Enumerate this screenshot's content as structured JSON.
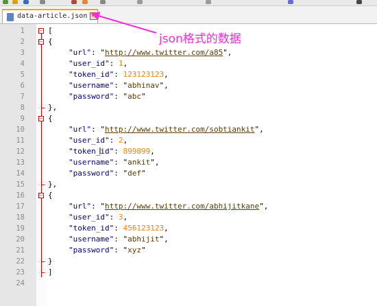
{
  "tab": {
    "filename": "data-article.json",
    "close_glyph": "✕"
  },
  "annotation": {
    "text": "json格式的数据",
    "color": "#ff2bd4"
  },
  "line_numbers": [
    "1",
    "2",
    "3",
    "4",
    "5",
    "6",
    "7",
    "8",
    "9",
    "10",
    "11",
    "12",
    "13",
    "14",
    "15",
    "16",
    "17",
    "18",
    "19",
    "20",
    "21",
    "22",
    "23",
    "24"
  ],
  "code": {
    "l1": "[",
    "l2": "{",
    "records": [
      {
        "url": "http://www.twitter.com/a85",
        "user_id": "1",
        "token_id": "123123123",
        "username": "abhinav",
        "password": "abc"
      },
      {
        "url": "http://www.twitter.com/sobtiankit",
        "user_id": "2",
        "token_id": "899899",
        "username": "ankit",
        "password": "def"
      },
      {
        "url": "http://www.twitter.com/abhijitkane",
        "user_id": "3",
        "token_id": "456123123",
        "username": "abhijit",
        "password": "xyz"
      }
    ],
    "keys": {
      "url": "\"url\"",
      "user_id": "\"user_id\"",
      "token_id": "\"token_id\"",
      "username": "\"username\"",
      "password": "\"password\""
    },
    "close_obj_comma": "},",
    "open_obj": "{",
    "close_obj": "}",
    "close_arr": "]"
  },
  "colors": {
    "accent_tab": "#f7a400",
    "fold_marker": "#cc0000",
    "number": "#ff8000"
  }
}
